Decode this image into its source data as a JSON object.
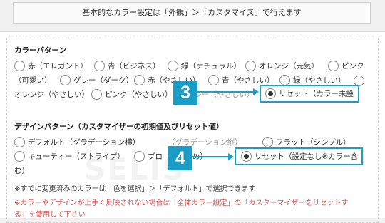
{
  "header": {
    "text": "基本的なカラー設定は「外観」＞「カスタマイズ」で行えます"
  },
  "color_pattern": {
    "title": "カラーパターン",
    "options": [
      "赤（エレガント）",
      "青（ビジネス）",
      "緑（ナチュラル）",
      "オレンジ（元気）",
      "ピンク",
      "（可愛い）",
      "グレー（ダーク）",
      "赤（やさしい）",
      "青（やさしい）",
      "緑（やさしい）",
      "オレンジ（やさしい）",
      "ピンク（やさしい）",
      "グレー（やさしい）",
      "リセット（カラー未設"
    ],
    "selected_index": 13
  },
  "design_pattern": {
    "title": "デザインパターン（カスタマイザーの初期値及びリセット値）",
    "options": [
      "デフォルト（グラデーション横）",
      "（グラデーション縦）",
      "フラット（シンプル）",
      "キューティー（ストライプ）",
      "ブロ（おすすめ）",
      "リセット（設定なし※カラー含",
      "む）"
    ],
    "selected_index": 5
  },
  "notes": {
    "line1": "※すでに変更済みのカラーは「色を選択」＞「デフォルト」で選択できます",
    "line2": "※カラーやデザインが上手く反映されない場合は「全体カラー設定」の「カスターマイザーをリセットす",
    "line3": "る」を使用して下さい"
  },
  "callouts": {
    "step3": "3",
    "step4": "4",
    "accent_color": "#1aa0c8"
  },
  "watermark": "SELIS"
}
